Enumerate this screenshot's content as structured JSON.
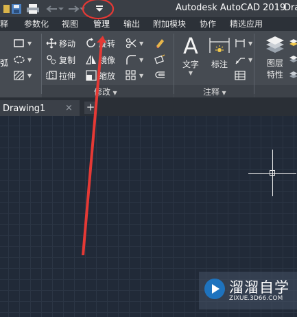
{
  "window": {
    "title": "Autodesk AutoCAD 2019",
    "title_suffix": "Dra"
  },
  "quick_access": [
    "open-file-icon",
    "save-icon",
    "print-icon",
    "undo-icon",
    "redo-icon",
    "customize-dropdown-icon"
  ],
  "ribbon_tabs": [
    "注释",
    "参数化",
    "视图",
    "管理",
    "输出",
    "附加模块",
    "协作",
    "精选应用"
  ],
  "modify_panel": {
    "title": "修改",
    "move": "移动",
    "rotate": "旋转",
    "copy": "复制",
    "mirror": "镜像",
    "stretch": "拉伸",
    "scale": "缩放"
  },
  "left_partial": "弧",
  "annotation_panel": {
    "title": "注释",
    "text": "文字",
    "dimension": "标注"
  },
  "layers_panel": {
    "layer_properties_line1": "图层",
    "layer_properties_line2": "特性"
  },
  "document": {
    "tab": "Drawing1",
    "close": "×",
    "add": "+"
  },
  "watermark": {
    "brand": "溜溜自学",
    "url": "ZIXUE.3D66.COM"
  },
  "colors": {
    "canvas": "#212a38",
    "ribbon": "#464b52",
    "annotation": "#e53935"
  }
}
